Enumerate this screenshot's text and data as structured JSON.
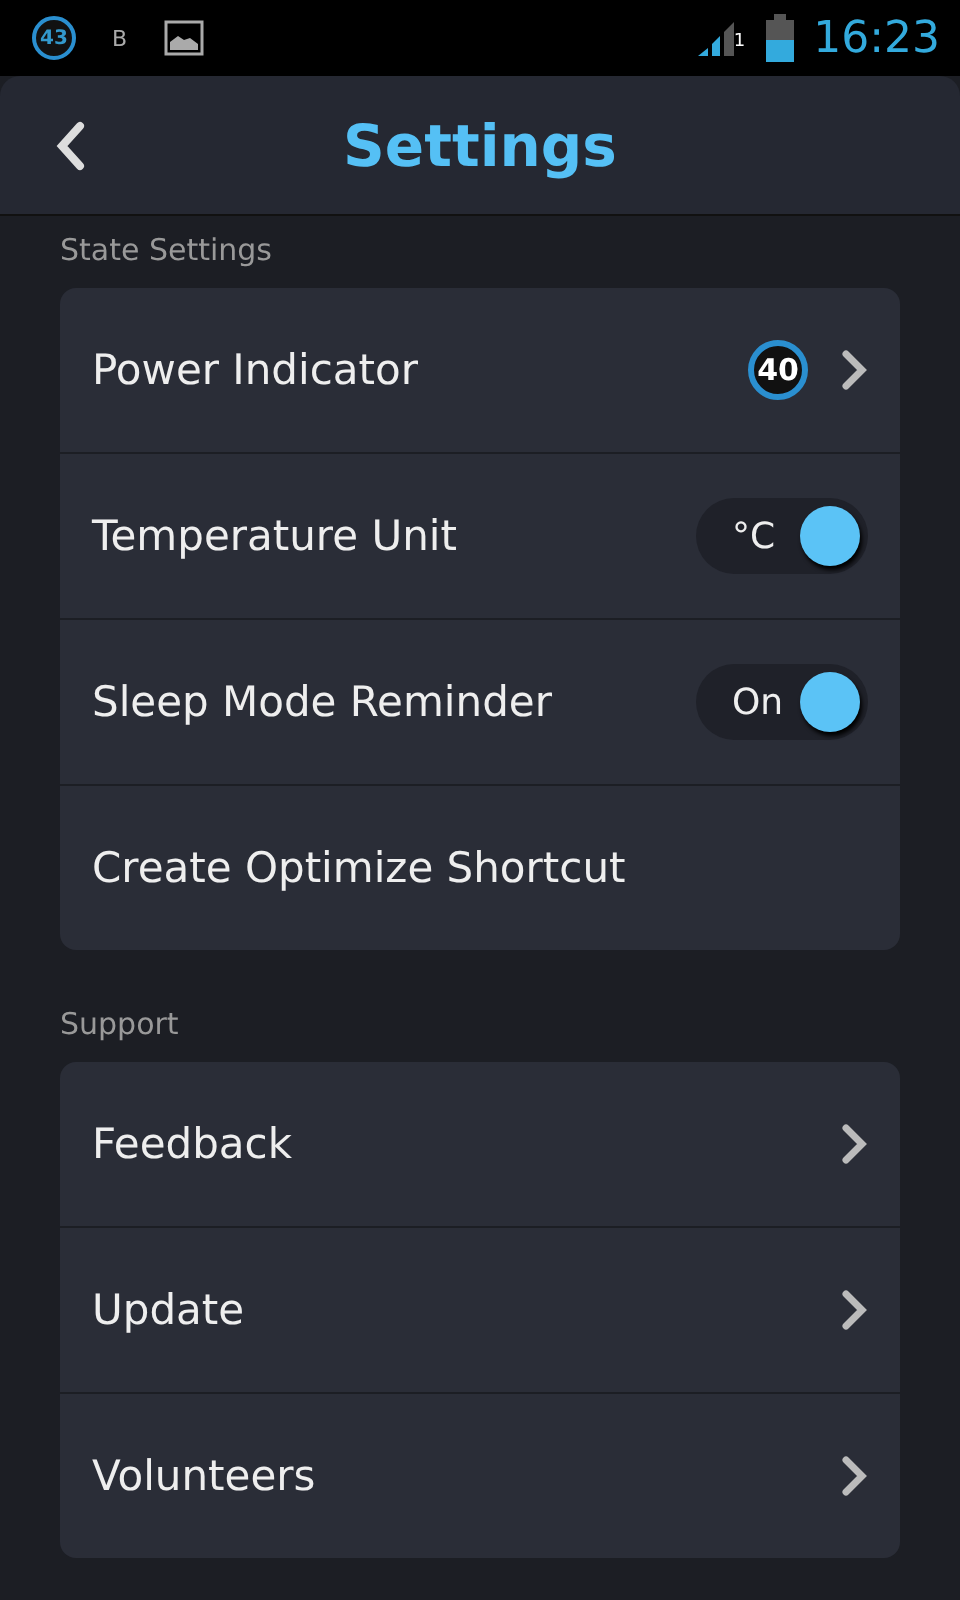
{
  "status_bar": {
    "notification_badge": "43",
    "notification_letter": "B",
    "time": "16:23",
    "sim_label": "1"
  },
  "header": {
    "title": "Settings"
  },
  "sections": [
    {
      "title": "State Settings",
      "items": [
        {
          "kind": "badge",
          "label": "Power Indicator",
          "badge": "40"
        },
        {
          "kind": "toggle",
          "label": "Temperature Unit",
          "toggle_text": "°C",
          "on": true
        },
        {
          "kind": "toggle",
          "label": "Sleep Mode Reminder",
          "toggle_text": "On",
          "on": true
        },
        {
          "kind": "plain",
          "label": "Create Optimize Shortcut"
        }
      ]
    },
    {
      "title": "Support",
      "items": [
        {
          "kind": "link",
          "label": "Feedback"
        },
        {
          "kind": "link",
          "label": "Update"
        },
        {
          "kind": "link",
          "label": "Volunteers"
        }
      ]
    }
  ]
}
